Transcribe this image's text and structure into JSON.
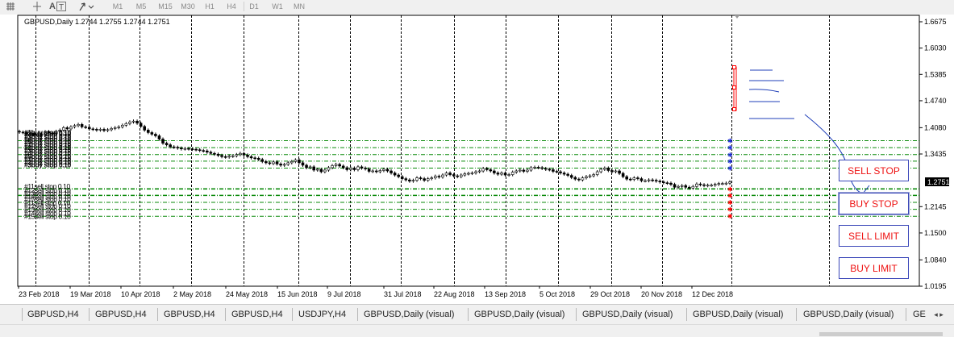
{
  "toolbar": {
    "timeframes": [
      "M1",
      "M5",
      "M15",
      "M30",
      "H1",
      "H4",
      "D1",
      "W1",
      "MN"
    ],
    "icons": [
      "grid-tool-icon",
      "crosshair-icon",
      "text-label-icon",
      "text-tool-icon",
      "arrow-tool-icon"
    ]
  },
  "chart": {
    "header": "GBPUSD,Daily  1.2744 1.2755 1.2744 1.2751",
    "current_price": "1.2751",
    "ylim": [
      1.0195,
      1.6675
    ],
    "price_labels": [
      "1.6675",
      "1.6030",
      "1.5385",
      "1.4740",
      "1.4080",
      "1.3435",
      "1.2751",
      "1.2145",
      "1.1500",
      "1.0840",
      "1.0195"
    ],
    "date_labels": [
      "23 Feb 2018",
      "19 Mar 2018",
      "10 Apr 2018",
      "2 May 2018",
      "24 May 2018",
      "15 Jun 2018",
      "9 Jul 2018",
      "31 Jul 2018",
      "22 Aug 2018",
      "13 Sep 2018",
      "5 Oct 2018",
      "29 Oct 2018",
      "20 Nov 2018",
      "12 Dec 2018"
    ],
    "closes": [
      1.397,
      1.396,
      1.392,
      1.394,
      1.389,
      1.392,
      1.39,
      1.398,
      1.395,
      1.393,
      1.399,
      1.402,
      1.408,
      1.405,
      1.41,
      1.413,
      1.416,
      1.41,
      1.409,
      1.405,
      1.404,
      1.402,
      1.404,
      1.401,
      1.403,
      1.406,
      1.408,
      1.41,
      1.414,
      1.418,
      1.422,
      1.424,
      1.419,
      1.411,
      1.402,
      1.396,
      1.392,
      1.388,
      1.38,
      1.37,
      1.366,
      1.361,
      1.36,
      1.358,
      1.356,
      1.357,
      1.356,
      1.355,
      1.354,
      1.352,
      1.351,
      1.348,
      1.345,
      1.343,
      1.34,
      1.337,
      1.336,
      1.338,
      1.339,
      1.342,
      1.345,
      1.341,
      1.337,
      1.334,
      1.333,
      1.33,
      1.325,
      1.322,
      1.32,
      1.324,
      1.319,
      1.316,
      1.318,
      1.322,
      1.325,
      1.329,
      1.322,
      1.316,
      1.31,
      1.312,
      1.304,
      1.306,
      1.3,
      1.304,
      1.31,
      1.315,
      1.318,
      1.314,
      1.31,
      1.305,
      1.309,
      1.305,
      1.312,
      1.309,
      1.307,
      1.301,
      1.302,
      1.3,
      1.303,
      1.306,
      1.302,
      1.297,
      1.292,
      1.288,
      1.283,
      1.28,
      1.277,
      1.279,
      1.285,
      1.283,
      1.279,
      1.283,
      1.285,
      1.289,
      1.287,
      1.292,
      1.297,
      1.293,
      1.29,
      1.288,
      1.292,
      1.295,
      1.296,
      1.297,
      1.3,
      1.302,
      1.308,
      1.305,
      1.302,
      1.297,
      1.294,
      1.297,
      1.292,
      1.293,
      1.299,
      1.302,
      1.304,
      1.301,
      1.304,
      1.31,
      1.311,
      1.31,
      1.308,
      1.306,
      1.305,
      1.301,
      1.3,
      1.297,
      1.294,
      1.291,
      1.286,
      1.282,
      1.28,
      1.285,
      1.288,
      1.29,
      1.293,
      1.3,
      1.306,
      1.309,
      1.303,
      1.3,
      1.302,
      1.296,
      1.288,
      1.282,
      1.281,
      1.285,
      1.283,
      1.278,
      1.278,
      1.28,
      1.279,
      1.277,
      1.275,
      1.273,
      1.272,
      1.269,
      1.262,
      1.264,
      1.266,
      1.262,
      1.26,
      1.264,
      1.27,
      1.268,
      1.266,
      1.267,
      1.267,
      1.269,
      1.271,
      1.271,
      1.272,
      1.275
    ],
    "stop_labels": [
      "#1buy stop 0.10",
      "#2buy stop 0.10",
      "#3buy stop 0.10",
      "#4buy stop 0.10",
      "#5buy stop 0.10",
      "#11sell stop 0.10",
      "#12sell stop 0.10",
      "#13sell stop 0.10",
      "#14sell stop 0.10",
      "#15sell stop 0.10"
    ],
    "levels": {
      "blue_stars": [
        1.376,
        1.359,
        1.342,
        1.326,
        1.309
      ],
      "red_stars": [
        1.258,
        1.242,
        1.225,
        1.208,
        1.191
      ],
      "green_lines": [
        1.376,
        1.359,
        1.342,
        1.326,
        1.309,
        1.258,
        1.242,
        1.225,
        1.208,
        1.191
      ]
    }
  },
  "buttons": {
    "sell_stop": "SELL STOP",
    "buy_stop": "BUY STOP",
    "sell_limit": "SELL LIMIT",
    "buy_limit": "BUY LIMIT"
  },
  "tabs": [
    "GBPUSD,H4",
    "GBPUSD,H4",
    "GBPUSD,H4",
    "GBPUSD,H4",
    "USDJPY,H4",
    "GBPUSD,Daily (visual)",
    "GBPUSD,Daily (visual)",
    "GBPUSD,Daily (visual)",
    "GBPUSD,Daily (visual)",
    "GBPUSD,Daily (visual)",
    "GE"
  ],
  "tab_more": "◂ ▸",
  "colors": {
    "grid": "#000000",
    "level_line": "#0a8a0a",
    "sell_marker": "#ff0000",
    "buy_marker": "#1c2bd6",
    "annotation": "#1f3fb8",
    "current_price_bg": "#000000"
  }
}
